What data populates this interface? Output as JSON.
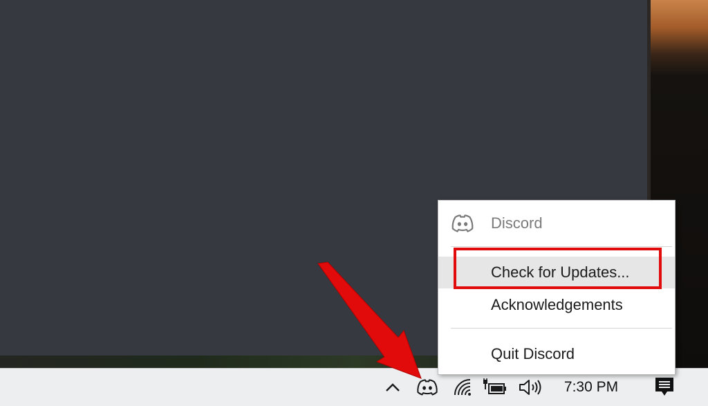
{
  "app_window": {
    "name": "Discord"
  },
  "context_menu": {
    "header": {
      "label": "Discord",
      "icon": "discord-icon"
    },
    "items": [
      {
        "label": "Check for Updates...",
        "highlighted": true
      },
      {
        "label": "Acknowledgements"
      },
      {
        "label": "Quit Discord"
      }
    ]
  },
  "taskbar": {
    "tray_icons": [
      "chevron-up-icon",
      "discord-icon",
      "wifi-icon",
      "battery-charging-icon",
      "volume-icon",
      "notifications-icon"
    ],
    "clock": "7:30 PM"
  },
  "colors": {
    "app_background": "#36393f",
    "annotation_red": "#e10b0b",
    "menu_hover": "#e6e6e6",
    "taskbar": "#eceef0"
  }
}
